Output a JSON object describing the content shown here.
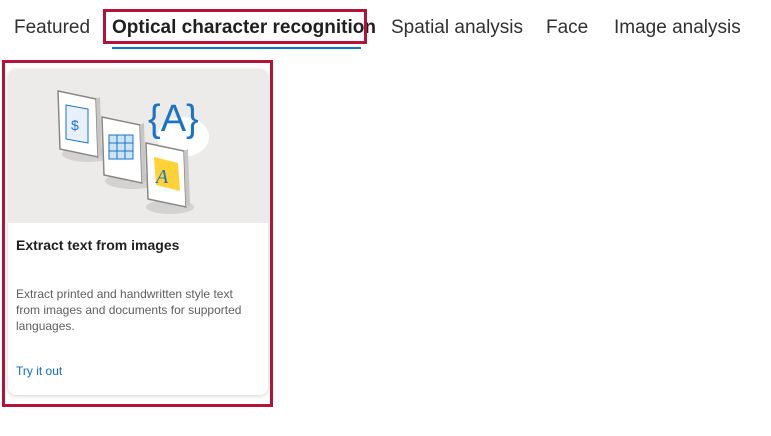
{
  "tabs": [
    {
      "label": "Featured"
    },
    {
      "label": "Optical character recognition"
    },
    {
      "label": "Spatial analysis"
    },
    {
      "label": "Face"
    },
    {
      "label": "Image analysis"
    }
  ],
  "card": {
    "title": "Extract text from images",
    "description": "Extract printed and handwritten style text from images and documents for supported languages.",
    "link": "Try it out",
    "image_icons": [
      "receipt-icon",
      "table-document-icon",
      "handwriting-a-icon",
      "braces-a-icon"
    ]
  },
  "colors": {
    "accent": "#0078d4",
    "highlight": "#b4123a",
    "link": "#0f6cbd"
  }
}
